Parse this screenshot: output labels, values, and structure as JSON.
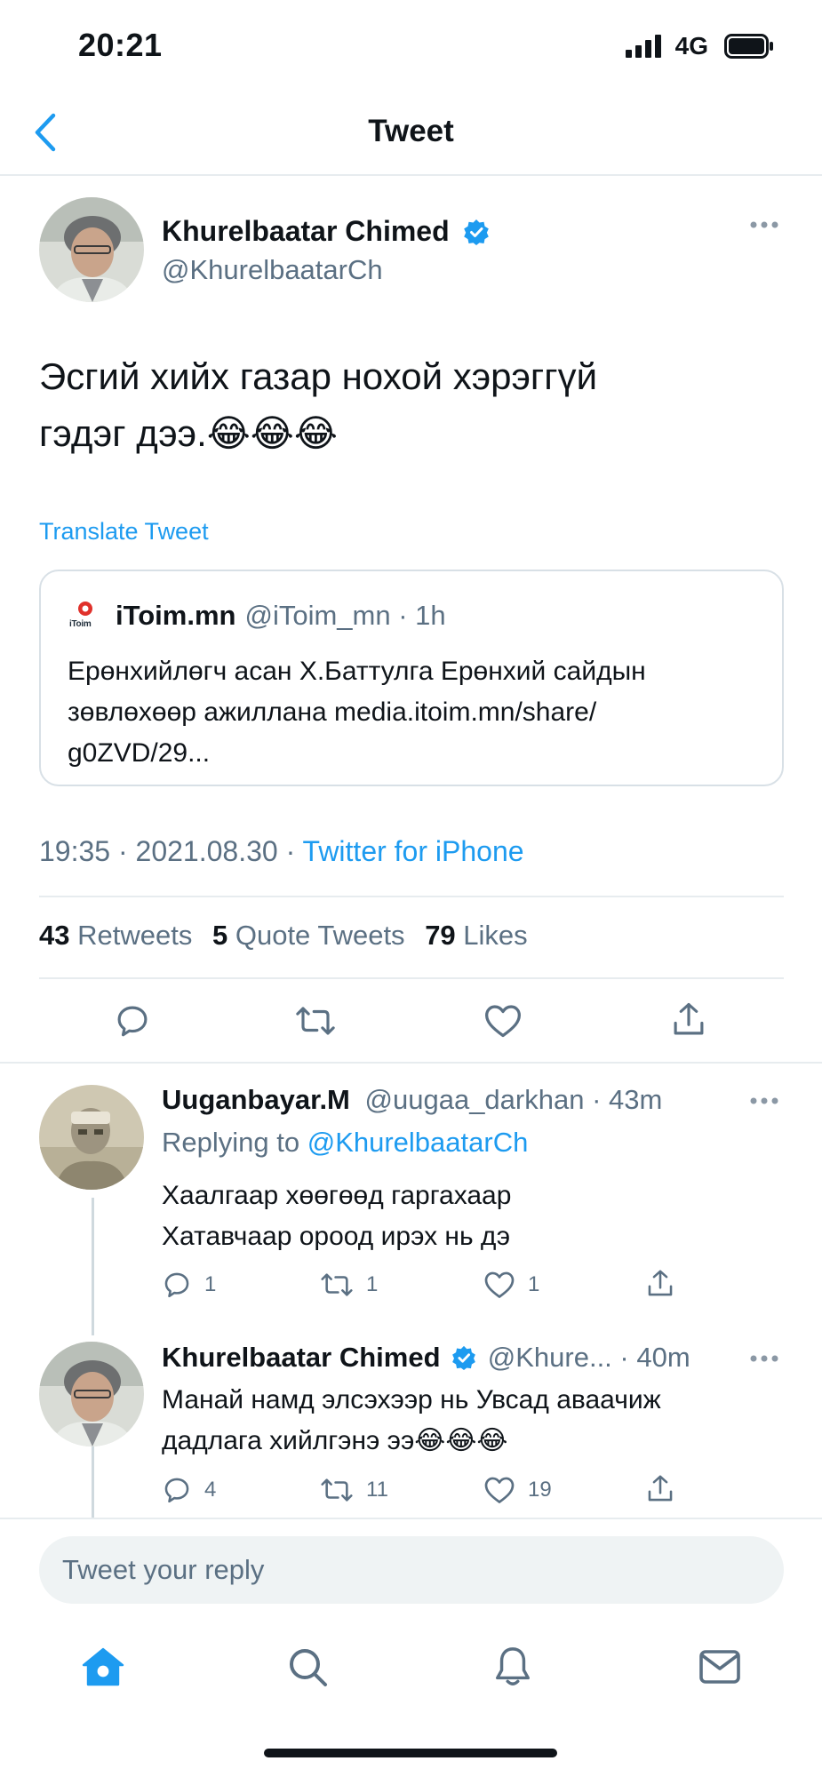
{
  "status_bar": {
    "time": "20:21",
    "network": "4G"
  },
  "nav": {
    "title": "Tweet"
  },
  "tweet": {
    "author_name": "Khurelbaatar Chimed",
    "handle": "@KhurelbaatarCh",
    "text_line1": "Эсгий хийх газар нохой хэрэггүй",
    "text_line2": "гэдэг дээ.😂😂😂",
    "translate": "Translate Tweet",
    "quote": {
      "logo_text": "iToim",
      "name": "iToim.mn",
      "handle_time": "@iToim_mn · 1h",
      "line1": "Ерөнхийлөгч асан Х.Баттулга Ерөнхий сайдын",
      "line2": "зөвлөхөөр ажиллана media.itoim.mn/share/",
      "line3": "g0ZVD/29..."
    },
    "timestamp": "19:35 · 2021.08.30 · ",
    "source": "Twitter for iPhone",
    "retweets_count": "43",
    "retweets_label": "Retweets",
    "quotes_count": "5",
    "quotes_label": "Quote Tweets",
    "likes_count": "79",
    "likes_label": "Likes"
  },
  "replies": [
    {
      "name": "Uuganbayar.M",
      "handle_time": "@uugaa_darkhan · 43m",
      "replying_prefix": "Replying to ",
      "replying_handle": "@KhurelbaatarCh",
      "line1": "Хаалгаар хөөгөөд гаргахаар",
      "line2": "Хатавчаар ороод ирэх нь дэ",
      "reply_count": "1",
      "retweet_count": "1",
      "like_count": "1"
    },
    {
      "name": "Khurelbaatar Chimed",
      "handle_time": "@Khure... · 40m",
      "line1": "Манай намд элсэхээр нь Увсад аваачиж",
      "line2": "дадлага хийлгэнэ ээ😂😂😂",
      "reply_count": "4",
      "retweet_count": "11",
      "like_count": "19"
    }
  ],
  "compose": {
    "placeholder": "Tweet your reply"
  },
  "colors": {
    "accent": "#1d9bf0",
    "muted": "#5b7083",
    "text": "#0f1419",
    "divider": "#e7ecef"
  }
}
